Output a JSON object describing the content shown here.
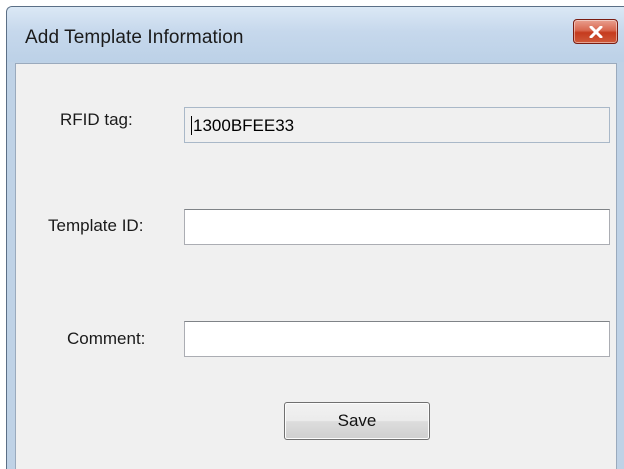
{
  "window": {
    "title": "Add Template Information"
  },
  "icons": {
    "close": "close-x-icon"
  },
  "colors": {
    "title_bar": "#bfd2e6",
    "client_background": "#f0f0f0",
    "close_button": "#c94a2c"
  },
  "form": {
    "rfid": {
      "label": "RFID tag:",
      "value": "1300BFEE33"
    },
    "template_id": {
      "label": "Template ID:",
      "value": ""
    },
    "comment": {
      "label": "Comment:",
      "value": ""
    },
    "save_label": "Save"
  }
}
